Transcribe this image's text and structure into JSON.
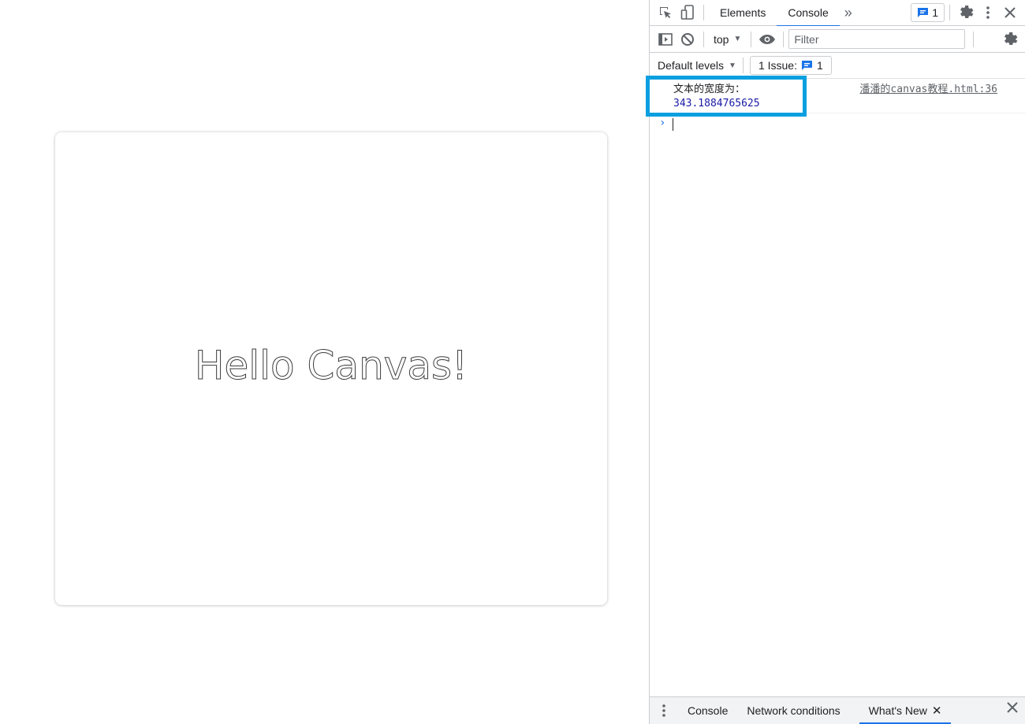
{
  "canvas": {
    "text": "Hello Canvas!"
  },
  "devtools": {
    "main_tabs": [
      {
        "label": "Elements"
      },
      {
        "label": "Console"
      }
    ],
    "issue_badge_count": "1",
    "toolbar": {
      "context": "top",
      "filter_placeholder": "Filter"
    },
    "levels": {
      "label": "Default levels",
      "issues_label": "1 Issue:",
      "issues_count": "1"
    },
    "console": {
      "message_text": "文本的宽度为：",
      "message_value": "343.1884765625",
      "message_source": "潘潘的canvas教程.html:36",
      "prompt": "›"
    },
    "drawer": {
      "tabs": [
        {
          "label": "Console"
        },
        {
          "label": "Network conditions"
        },
        {
          "label": "What's New"
        }
      ]
    },
    "colors": {
      "accent": "#1a73e8",
      "highlight_box": "#0aa0e0",
      "log_number": "#1a1aa6"
    },
    "icons": [
      "inspect-element-icon",
      "device-toggle-icon",
      "more-tabs-icon",
      "issue-chat-icon",
      "settings-gear-icon",
      "kebab-menu-icon",
      "close-icon",
      "sidebar-toggle-icon",
      "clear-console-icon",
      "live-expression-eye-icon"
    ]
  }
}
